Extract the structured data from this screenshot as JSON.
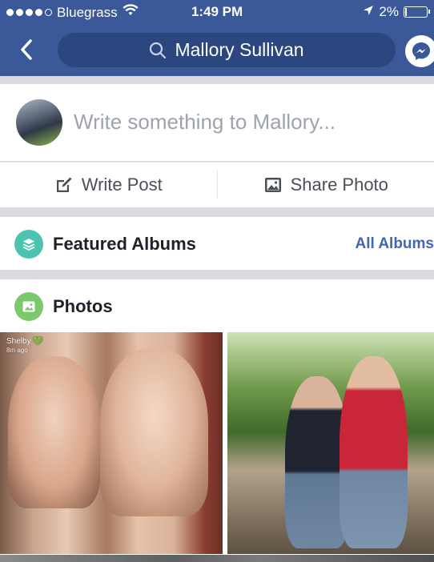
{
  "status_bar": {
    "carrier": "Bluegrass",
    "time": "1:49 PM",
    "battery_percent": "2%",
    "signal_bars_filled": 4,
    "signal_bars_total": 5
  },
  "nav": {
    "search_text": "Mallory Sullivan",
    "icons": {
      "back": "chevron-left-icon",
      "search": "search-icon",
      "messenger": "messenger-icon"
    }
  },
  "composer": {
    "placeholder": "Write something to Mallory..."
  },
  "actions": {
    "write_post": "Write Post",
    "share_photo": "Share Photo"
  },
  "featured_albums": {
    "title": "Featured Albums",
    "link": "All Albums",
    "icon_color": "#4cc3b0"
  },
  "photos": {
    "title": "Photos",
    "icon_color": "#7bc96b",
    "items": [
      {
        "caption_name": "Shelby 💚",
        "caption_time": "8m ago"
      },
      {
        "caption_name": "",
        "caption_time": ""
      }
    ]
  },
  "colors": {
    "brand": "#3b5998",
    "search_pill": "#2c4780",
    "link": "#4267b2"
  }
}
